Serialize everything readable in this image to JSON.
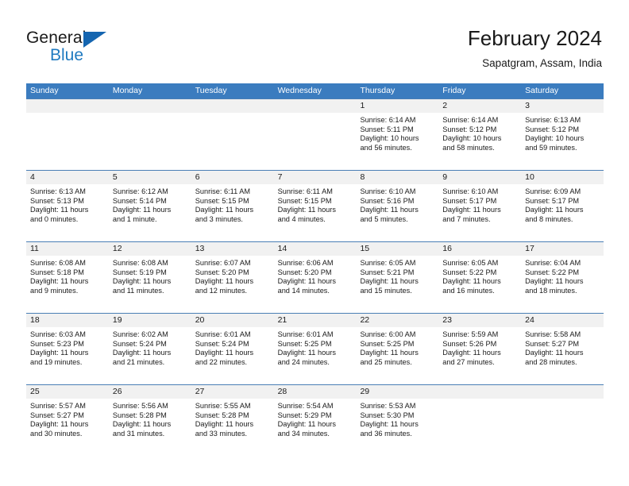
{
  "brand": {
    "logo_primary": "General",
    "logo_secondary": "Blue",
    "logo_triangle_icon": "triangle-icon",
    "accent_color": "#1f7ac0"
  },
  "header": {
    "title": "February 2024",
    "subtitle": "Sapatgram, Assam, India"
  },
  "theme": {
    "header_row_bg": "#3b7cbf",
    "header_row_text": "#ffffff",
    "daynum_band_bg": "#f1f1f1",
    "row_divider": "#4a7fb5",
    "body_text": "#1a1a1a"
  },
  "calendar": {
    "weekday_headers": [
      "Sunday",
      "Monday",
      "Tuesday",
      "Wednesday",
      "Thursday",
      "Friday",
      "Saturday"
    ],
    "weeks": [
      [
        {
          "day": "",
          "sunrise": "",
          "sunset": "",
          "daylight_line1": "",
          "daylight_line2": ""
        },
        {
          "day": "",
          "sunrise": "",
          "sunset": "",
          "daylight_line1": "",
          "daylight_line2": ""
        },
        {
          "day": "",
          "sunrise": "",
          "sunset": "",
          "daylight_line1": "",
          "daylight_line2": ""
        },
        {
          "day": "",
          "sunrise": "",
          "sunset": "",
          "daylight_line1": "",
          "daylight_line2": ""
        },
        {
          "day": "1",
          "sunrise": "Sunrise: 6:14 AM",
          "sunset": "Sunset: 5:11 PM",
          "daylight_line1": "Daylight: 10 hours",
          "daylight_line2": "and 56 minutes."
        },
        {
          "day": "2",
          "sunrise": "Sunrise: 6:14 AM",
          "sunset": "Sunset: 5:12 PM",
          "daylight_line1": "Daylight: 10 hours",
          "daylight_line2": "and 58 minutes."
        },
        {
          "day": "3",
          "sunrise": "Sunrise: 6:13 AM",
          "sunset": "Sunset: 5:12 PM",
          "daylight_line1": "Daylight: 10 hours",
          "daylight_line2": "and 59 minutes."
        }
      ],
      [
        {
          "day": "4",
          "sunrise": "Sunrise: 6:13 AM",
          "sunset": "Sunset: 5:13 PM",
          "daylight_line1": "Daylight: 11 hours",
          "daylight_line2": "and 0 minutes."
        },
        {
          "day": "5",
          "sunrise": "Sunrise: 6:12 AM",
          "sunset": "Sunset: 5:14 PM",
          "daylight_line1": "Daylight: 11 hours",
          "daylight_line2": "and 1 minute."
        },
        {
          "day": "6",
          "sunrise": "Sunrise: 6:11 AM",
          "sunset": "Sunset: 5:15 PM",
          "daylight_line1": "Daylight: 11 hours",
          "daylight_line2": "and 3 minutes."
        },
        {
          "day": "7",
          "sunrise": "Sunrise: 6:11 AM",
          "sunset": "Sunset: 5:15 PM",
          "daylight_line1": "Daylight: 11 hours",
          "daylight_line2": "and 4 minutes."
        },
        {
          "day": "8",
          "sunrise": "Sunrise: 6:10 AM",
          "sunset": "Sunset: 5:16 PM",
          "daylight_line1": "Daylight: 11 hours",
          "daylight_line2": "and 5 minutes."
        },
        {
          "day": "9",
          "sunrise": "Sunrise: 6:10 AM",
          "sunset": "Sunset: 5:17 PM",
          "daylight_line1": "Daylight: 11 hours",
          "daylight_line2": "and 7 minutes."
        },
        {
          "day": "10",
          "sunrise": "Sunrise: 6:09 AM",
          "sunset": "Sunset: 5:17 PM",
          "daylight_line1": "Daylight: 11 hours",
          "daylight_line2": "and 8 minutes."
        }
      ],
      [
        {
          "day": "11",
          "sunrise": "Sunrise: 6:08 AM",
          "sunset": "Sunset: 5:18 PM",
          "daylight_line1": "Daylight: 11 hours",
          "daylight_line2": "and 9 minutes."
        },
        {
          "day": "12",
          "sunrise": "Sunrise: 6:08 AM",
          "sunset": "Sunset: 5:19 PM",
          "daylight_line1": "Daylight: 11 hours",
          "daylight_line2": "and 11 minutes."
        },
        {
          "day": "13",
          "sunrise": "Sunrise: 6:07 AM",
          "sunset": "Sunset: 5:20 PM",
          "daylight_line1": "Daylight: 11 hours",
          "daylight_line2": "and 12 minutes."
        },
        {
          "day": "14",
          "sunrise": "Sunrise: 6:06 AM",
          "sunset": "Sunset: 5:20 PM",
          "daylight_line1": "Daylight: 11 hours",
          "daylight_line2": "and 14 minutes."
        },
        {
          "day": "15",
          "sunrise": "Sunrise: 6:05 AM",
          "sunset": "Sunset: 5:21 PM",
          "daylight_line1": "Daylight: 11 hours",
          "daylight_line2": "and 15 minutes."
        },
        {
          "day": "16",
          "sunrise": "Sunrise: 6:05 AM",
          "sunset": "Sunset: 5:22 PM",
          "daylight_line1": "Daylight: 11 hours",
          "daylight_line2": "and 16 minutes."
        },
        {
          "day": "17",
          "sunrise": "Sunrise: 6:04 AM",
          "sunset": "Sunset: 5:22 PM",
          "daylight_line1": "Daylight: 11 hours",
          "daylight_line2": "and 18 minutes."
        }
      ],
      [
        {
          "day": "18",
          "sunrise": "Sunrise: 6:03 AM",
          "sunset": "Sunset: 5:23 PM",
          "daylight_line1": "Daylight: 11 hours",
          "daylight_line2": "and 19 minutes."
        },
        {
          "day": "19",
          "sunrise": "Sunrise: 6:02 AM",
          "sunset": "Sunset: 5:24 PM",
          "daylight_line1": "Daylight: 11 hours",
          "daylight_line2": "and 21 minutes."
        },
        {
          "day": "20",
          "sunrise": "Sunrise: 6:01 AM",
          "sunset": "Sunset: 5:24 PM",
          "daylight_line1": "Daylight: 11 hours",
          "daylight_line2": "and 22 minutes."
        },
        {
          "day": "21",
          "sunrise": "Sunrise: 6:01 AM",
          "sunset": "Sunset: 5:25 PM",
          "daylight_line1": "Daylight: 11 hours",
          "daylight_line2": "and 24 minutes."
        },
        {
          "day": "22",
          "sunrise": "Sunrise: 6:00 AM",
          "sunset": "Sunset: 5:25 PM",
          "daylight_line1": "Daylight: 11 hours",
          "daylight_line2": "and 25 minutes."
        },
        {
          "day": "23",
          "sunrise": "Sunrise: 5:59 AM",
          "sunset": "Sunset: 5:26 PM",
          "daylight_line1": "Daylight: 11 hours",
          "daylight_line2": "and 27 minutes."
        },
        {
          "day": "24",
          "sunrise": "Sunrise: 5:58 AM",
          "sunset": "Sunset: 5:27 PM",
          "daylight_line1": "Daylight: 11 hours",
          "daylight_line2": "and 28 minutes."
        }
      ],
      [
        {
          "day": "25",
          "sunrise": "Sunrise: 5:57 AM",
          "sunset": "Sunset: 5:27 PM",
          "daylight_line1": "Daylight: 11 hours",
          "daylight_line2": "and 30 minutes."
        },
        {
          "day": "26",
          "sunrise": "Sunrise: 5:56 AM",
          "sunset": "Sunset: 5:28 PM",
          "daylight_line1": "Daylight: 11 hours",
          "daylight_line2": "and 31 minutes."
        },
        {
          "day": "27",
          "sunrise": "Sunrise: 5:55 AM",
          "sunset": "Sunset: 5:28 PM",
          "daylight_line1": "Daylight: 11 hours",
          "daylight_line2": "and 33 minutes."
        },
        {
          "day": "28",
          "sunrise": "Sunrise: 5:54 AM",
          "sunset": "Sunset: 5:29 PM",
          "daylight_line1": "Daylight: 11 hours",
          "daylight_line2": "and 34 minutes."
        },
        {
          "day": "29",
          "sunrise": "Sunrise: 5:53 AM",
          "sunset": "Sunset: 5:30 PM",
          "daylight_line1": "Daylight: 11 hours",
          "daylight_line2": "and 36 minutes."
        },
        {
          "day": "",
          "sunrise": "",
          "sunset": "",
          "daylight_line1": "",
          "daylight_line2": ""
        },
        {
          "day": "",
          "sunrise": "",
          "sunset": "",
          "daylight_line1": "",
          "daylight_line2": ""
        }
      ]
    ]
  }
}
